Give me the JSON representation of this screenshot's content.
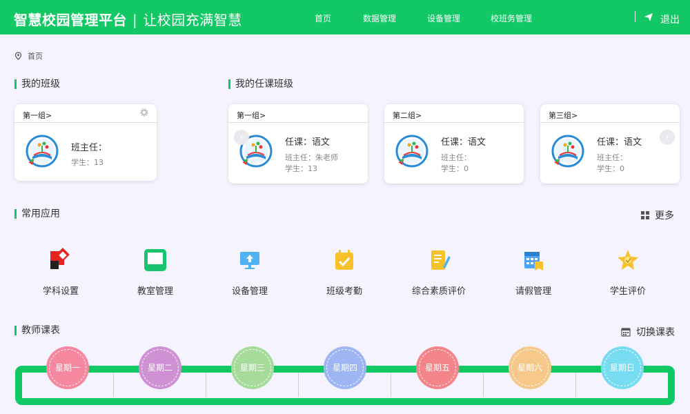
{
  "header": {
    "title": "智慧校园管理平台",
    "separator": "|",
    "slogan": "让校园充满智慧",
    "nav": [
      "首页",
      "数据管理",
      "设备管理",
      "校班务管理"
    ],
    "logout": "退出",
    "bg_color": "#12c864"
  },
  "breadcrumb": {
    "icon": "location-pin-icon",
    "text": "首页"
  },
  "my_class": {
    "title": "我的班级",
    "card": {
      "group": "第一组>",
      "head_teacher": "班主任：",
      "students": "学生：13"
    }
  },
  "teaching_classes": {
    "title": "我的任课班级",
    "cards": [
      {
        "group": "第一组>",
        "subject": "任课：语文",
        "head_teacher": "班主任：朱老师",
        "students": "学生：13"
      },
      {
        "group": "第二组>",
        "subject": "任课：语文",
        "head_teacher": "班主任：",
        "students": "学生：0"
      },
      {
        "group": "第三组>",
        "subject": "任课：语文",
        "head_teacher": "班主任：",
        "students": "学生：0"
      }
    ]
  },
  "apps": {
    "title": "常用应用",
    "more": "更多",
    "items": [
      {
        "label": "学科设置",
        "icon": "subject-settings-icon"
      },
      {
        "label": "教室管理",
        "icon": "classroom-icon"
      },
      {
        "label": "设备管理",
        "icon": "device-monitor-icon"
      },
      {
        "label": "班级考勤",
        "icon": "attendance-calendar-icon"
      },
      {
        "label": "综合素质评价",
        "icon": "evaluation-document-icon"
      },
      {
        "label": "请假管理",
        "icon": "leave-calendar-icon"
      },
      {
        "label": "学生评价",
        "icon": "star-badge-icon"
      }
    ]
  },
  "schedule": {
    "title": "教师课表",
    "switch_label": "切换课表",
    "days": [
      {
        "label": "星期一",
        "color": "#f5879f"
      },
      {
        "label": "星期二",
        "color": "#cf91d4"
      },
      {
        "label": "星期三",
        "color": "#a6db9b"
      },
      {
        "label": "星期四",
        "color": "#9db5f2"
      },
      {
        "label": "星期五",
        "color": "#f3848a"
      },
      {
        "label": "星期六",
        "color": "#f6c98a"
      },
      {
        "label": "星期日",
        "color": "#77dcf2"
      }
    ]
  }
}
